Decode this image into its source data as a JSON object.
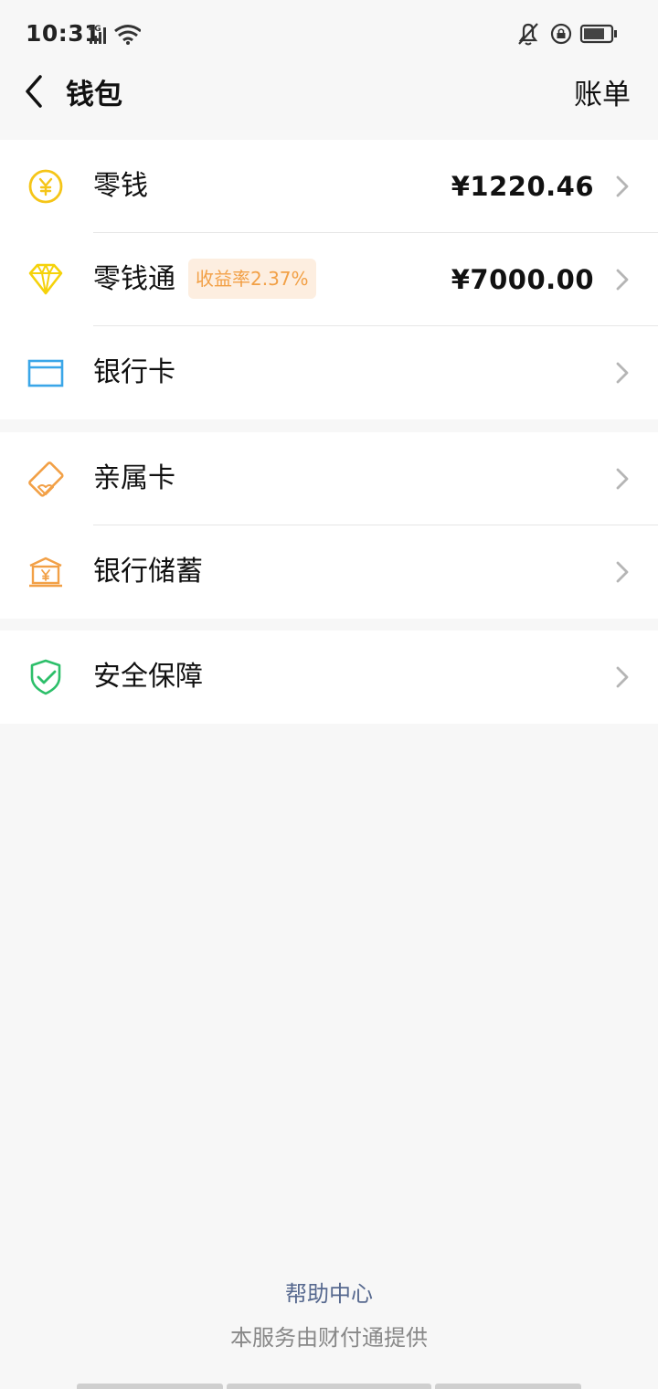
{
  "status_bar": {
    "time": "10:31",
    "network": "4G"
  },
  "nav": {
    "title": "钱包",
    "action": "账单"
  },
  "groups": [
    {
      "items": [
        {
          "label": "零钱",
          "amount": "¥1220.46",
          "icon": "yuan-coin-icon"
        },
        {
          "label": "零钱通",
          "badge": "收益率2.37%",
          "amount": "¥7000.00",
          "icon": "diamond-icon"
        },
        {
          "label": "银行卡",
          "icon": "bank-card-icon"
        }
      ]
    },
    {
      "items": [
        {
          "label": "亲属卡",
          "icon": "family-card-icon"
        },
        {
          "label": "银行储蓄",
          "icon": "bank-savings-icon"
        }
      ]
    },
    {
      "items": [
        {
          "label": "安全保障",
          "icon": "shield-check-icon"
        }
      ]
    }
  ],
  "footer": {
    "help": "帮助中心",
    "provider": "本服务由财付通提供"
  },
  "colors": {
    "coin": "#f5c518",
    "diamond": "#f5d20a",
    "card": "#3aa6e8",
    "family": "#f2a046",
    "savings": "#f2a046",
    "shield": "#2dbf6a",
    "badge_bg": "#fdeee0",
    "badge_text": "#f2a046",
    "link": "#57698f"
  }
}
